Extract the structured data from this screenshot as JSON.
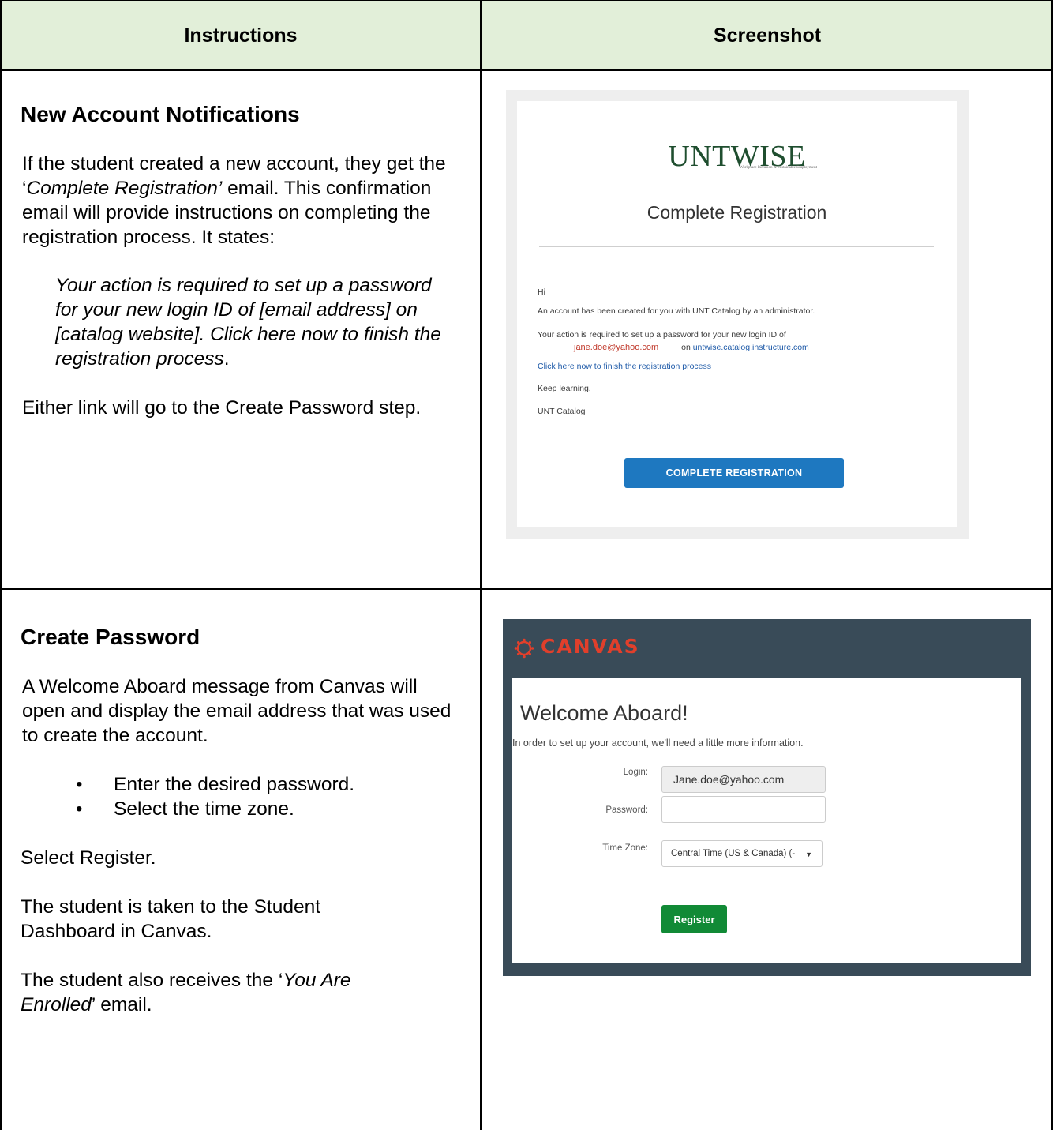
{
  "header": {
    "col1": "Instructions",
    "col2": "Screenshot"
  },
  "row1": {
    "heading": "New Account Notifications",
    "para1_a": "If the student created a new account, they get the ‘",
    "para1_em": "Complete Registration’",
    "para1_b": " email. This confirmation email will provide instructions on completing the registration process. It states:",
    "quote_main": "Your action is required to set up a password for your new login ID of [email address] on [catalog website]. Click here now to finish the registration process",
    "quote_end": ".",
    "para2": "Either link will go to the Create Password step."
  },
  "email": {
    "logo": "UNTWISE",
    "logo_sub": "Workplace Inclusion & Sustainable Employment",
    "title": "Complete Registration",
    "greeting": "Hi",
    "line1": "An account has been created for you with UNT Catalog by an administrator.",
    "line2": "Your action is required to set up a password for your new login ID of",
    "email_addr": "jane.doe@yahoo.com",
    "on_text": "on",
    "site_link": "untwise.catalog.instructure.com",
    "finish_link": "Click here now to finish the registration process",
    "signoff": "Keep learning,",
    "sender": "UNT Catalog",
    "cta": "COMPLETE REGISTRATION"
  },
  "row2": {
    "heading": "Create Password",
    "para1": "A Welcome Aboard message from Canvas will open and display the email address that was used to create the account.",
    "bullets": [
      "Enter the desired password.",
      "Select the time zone."
    ],
    "para2": "Select Register.",
    "para3": "The student is taken to the Student Dashboard in Canvas.",
    "para4_a": "The student also receives the ‘",
    "para4_em": "You Are Enrolled",
    "para4_b": "’ email."
  },
  "canvas": {
    "brand": "CANVAS",
    "title": "Welcome Aboard!",
    "subtitle": "In order to set up your account, we'll need a little more information.",
    "login_label": "Login:",
    "login_value": "Jane.doe@yahoo.com",
    "password_label": "Password:",
    "password_value": "",
    "timezone_label": "Time Zone:",
    "timezone_value": "Central Time (US & Canada) (-",
    "register": "Register"
  },
  "colors": {
    "header_bg": "#e2efd9",
    "canvas_dark": "#394b58",
    "canvas_red": "#e13f2b",
    "register_green": "#118a36",
    "cta_blue": "#1e78c0"
  }
}
